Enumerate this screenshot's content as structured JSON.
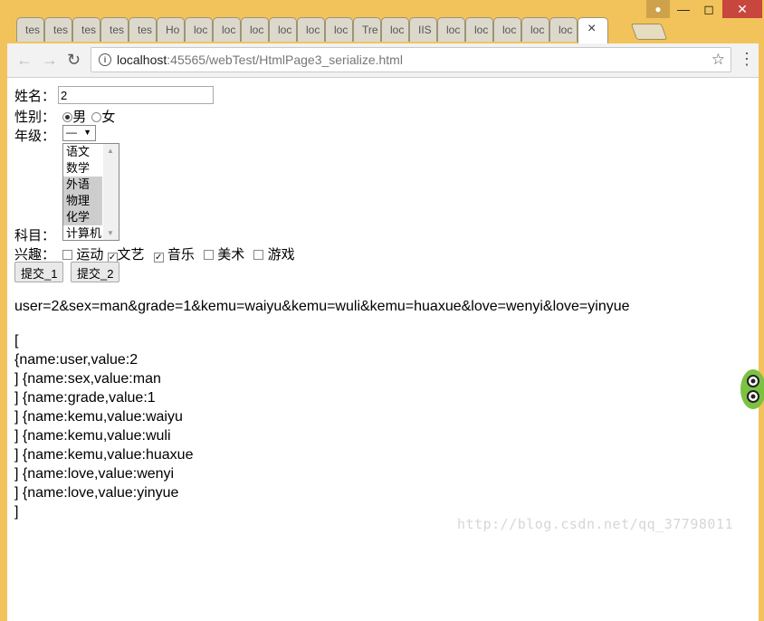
{
  "browser": {
    "tabs": [
      "tes",
      "tes",
      "tes",
      "tes",
      "tes",
      "Ho",
      "loc",
      "loc",
      "loc",
      "loc",
      "loc",
      "loc",
      "Tre",
      "loc",
      "IIS",
      "loc",
      "loc",
      "loc",
      "loc",
      "loc"
    ],
    "active_tab_close": "×",
    "url_host": "localhost",
    "url_rest": ":45565/webTest/HtmlPage3_serialize.html",
    "menu": "⋮",
    "star": "☆"
  },
  "form": {
    "name_label": "姓名：",
    "name_value": "2",
    "sex_label": "性别：",
    "sex_male": "男",
    "sex_female": "女",
    "grade_label": "年级：",
    "grade_value": "—",
    "subject_label": "科目：",
    "subjects": [
      "语文",
      "数学",
      "外语",
      "物理",
      "化学",
      "计算机"
    ],
    "hobby_label": "兴趣：",
    "hobbies": [
      "运动",
      "文艺",
      "音乐",
      "美术",
      "游戏"
    ],
    "submit1": "提交_1",
    "submit2": "提交_2"
  },
  "output": {
    "serialized": "user=2&sex=man&grade=1&kemu=waiyu&kemu=wuli&kemu=huaxue&love=wenyi&love=yinyue",
    "array_lines": [
      "[",
      "{name:user,value:2",
      "] {name:sex,value:man",
      "] {name:grade,value:1",
      "] {name:kemu,value:waiyu",
      "] {name:kemu,value:wuli",
      "] {name:kemu,value:huaxue",
      "] {name:love,value:wenyi",
      "] {name:love,value:yinyue",
      "]"
    ]
  },
  "watermark": "http://blog.csdn.net/qq_37798011"
}
